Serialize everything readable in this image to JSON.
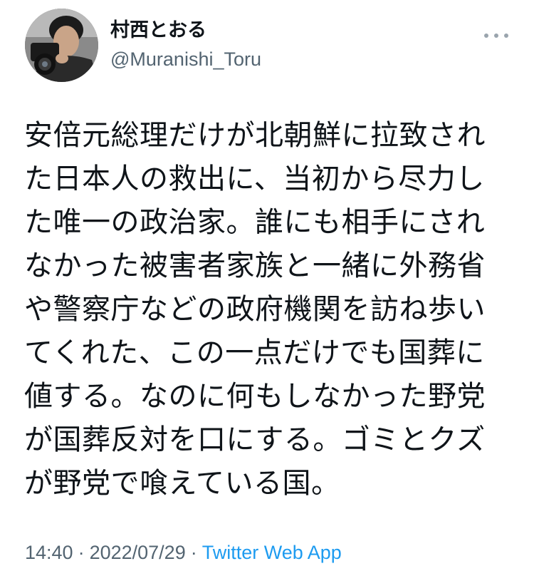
{
  "tweet": {
    "author": {
      "display_name": "村西とおる",
      "handle": "@Muranishi_Toru",
      "avatar_icon": "profile-photo-with-camera"
    },
    "more_icon": "ellipsis-icon",
    "text_lines": [
      "安倍元総理だけが北朝鮮に拉致され",
      "た日本人の救出に、当初から尽力し",
      "た唯一の政治家。誰にも相手にされ",
      "なかった被害者家族と一緒に外務省",
      "や警察庁などの政府機関を訪ね歩い",
      "てくれた、この一点だけでも国葬に",
      "値する。なのに何もしなかった野党",
      "が国葬反対を口にする。ゴミとクズ",
      "が野党で喰えている国。"
    ],
    "time": "14:40",
    "separator": "·",
    "date": "2022/07/29",
    "source": "Twitter Web App"
  },
  "colors": {
    "text": "#0f1419",
    "secondary": "#536471",
    "link": "#1d9bf0"
  }
}
